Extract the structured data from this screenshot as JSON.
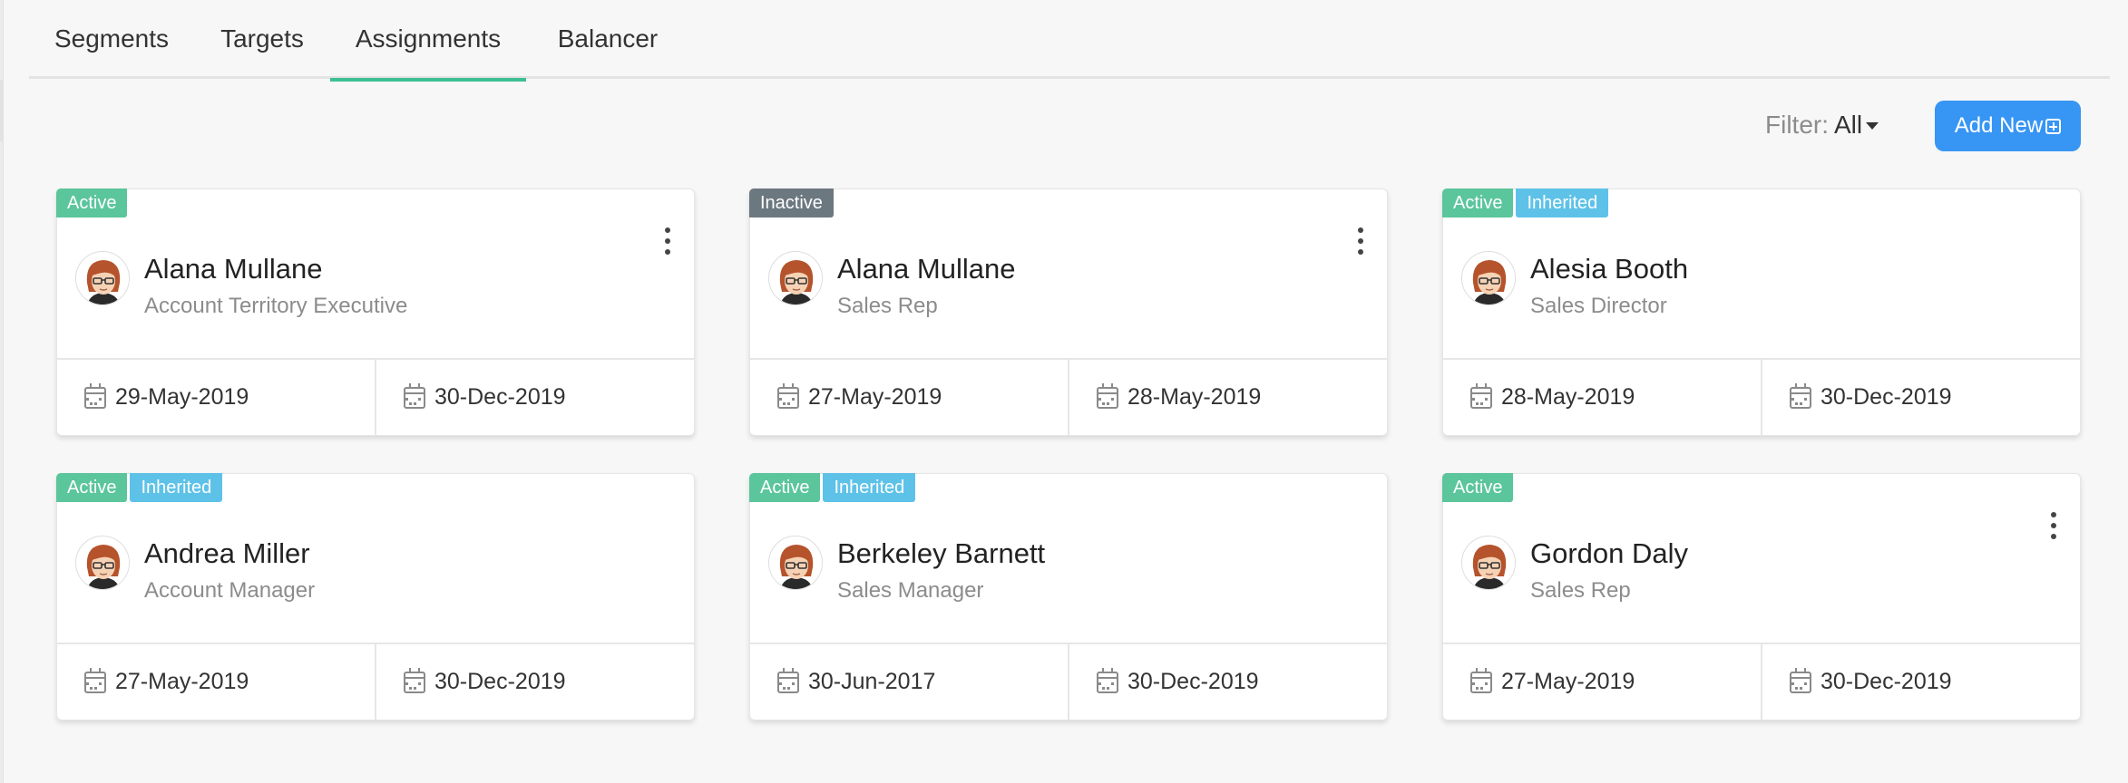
{
  "tabs": [
    {
      "label": "Segments",
      "active": false
    },
    {
      "label": "Targets",
      "active": false
    },
    {
      "label": "Assignments",
      "active": true
    },
    {
      "label": "Balancer",
      "active": false
    }
  ],
  "toolbar": {
    "filter_label": "Filter:",
    "filter_value": "All",
    "add_button_label": "Add New"
  },
  "colors": {
    "accent_tab": "#3dbf94",
    "button": "#3795f4",
    "badge_active": "#5bc59c",
    "badge_inactive": "#6c7880",
    "badge_inherited": "#5ec2e8"
  },
  "assignments": [
    {
      "badges": [
        "Active"
      ],
      "has_menu": true,
      "name": "Alana Mullane",
      "role": "Account Territory Executive",
      "start_date": "29-May-2019",
      "end_date": "30-Dec-2019"
    },
    {
      "badges": [
        "Inactive"
      ],
      "has_menu": true,
      "name": "Alana Mullane",
      "role": "Sales Rep",
      "start_date": "27-May-2019",
      "end_date": "28-May-2019"
    },
    {
      "badges": [
        "Active",
        "Inherited"
      ],
      "has_menu": false,
      "name": "Alesia Booth",
      "role": "Sales Director",
      "start_date": "28-May-2019",
      "end_date": "30-Dec-2019"
    },
    {
      "badges": [
        "Active",
        "Inherited"
      ],
      "has_menu": false,
      "name": "Andrea Miller",
      "role": "Account Manager",
      "start_date": "27-May-2019",
      "end_date": "30-Dec-2019"
    },
    {
      "badges": [
        "Active",
        "Inherited"
      ],
      "has_menu": false,
      "name": "Berkeley Barnett",
      "role": "Sales Manager",
      "start_date": "30-Jun-2017",
      "end_date": "30-Dec-2019"
    },
    {
      "badges": [
        "Active"
      ],
      "has_menu": true,
      "name": "Gordon Daly",
      "role": "Sales Rep",
      "start_date": "27-May-2019",
      "end_date": "30-Dec-2019"
    }
  ]
}
